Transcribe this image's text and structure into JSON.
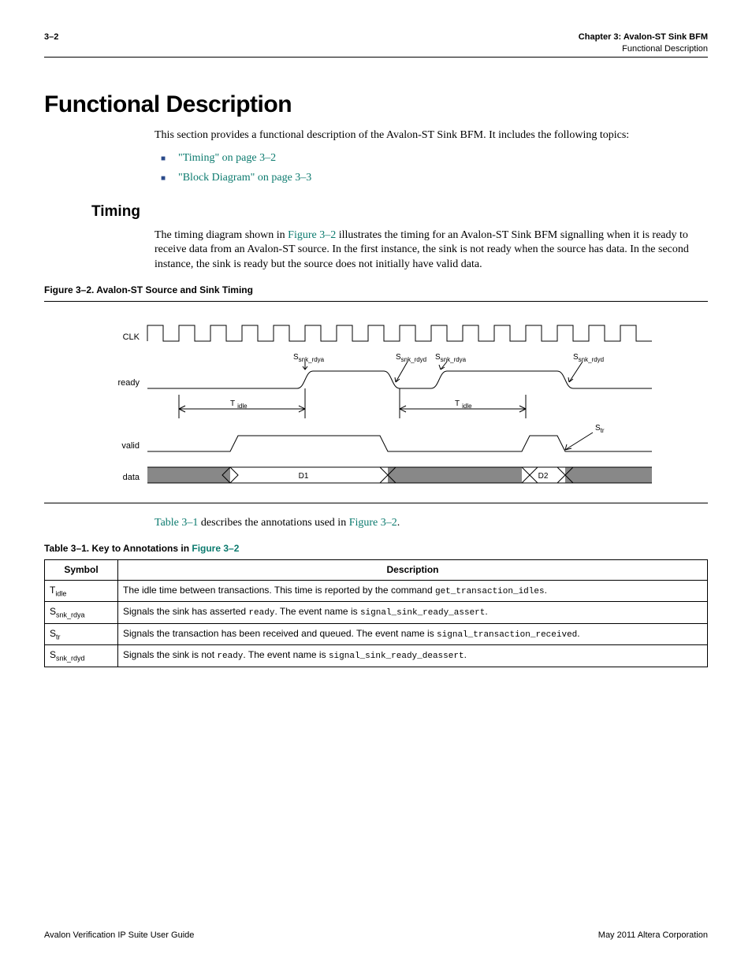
{
  "header": {
    "page_num": "3–2",
    "chapter": "Chapter 3: Avalon-ST Sink BFM",
    "section": "Functional Description"
  },
  "h1": "Functional Description",
  "intro": "This section provides a functional description of the Avalon-ST Sink BFM. It includes the following topics:",
  "bullets": [
    "\"Timing\" on page 3–2",
    "\"Block Diagram\" on page 3–3"
  ],
  "h2": "Timing",
  "timing_para_pre": "The timing diagram shown in ",
  "timing_para_link": "Figure 3–2",
  "timing_para_post": " illustrates the timing for an Avalon-ST Sink BFM signalling when it is ready to receive data from an Avalon-ST source. In the first instance, the sink is not ready when the source has data. In the second instance, the sink is ready but the source does not initially have valid data.",
  "fig_caption": "Figure 3–2. Avalon-ST Source and Sink Timing",
  "signals": {
    "clk": "CLK",
    "ready": "ready",
    "valid": "valid",
    "data": "data"
  },
  "annotations": {
    "s_snk_rdya": "S",
    "s_snk_rdya_sub": "snk_rdya",
    "s_snk_rdyd": "S",
    "s_snk_rdyd_sub": "snk_rdyd",
    "t_idle": "T",
    "t_idle_sub": "idle",
    "s_tr": "S",
    "s_tr_sub": "tr",
    "d1": "D1",
    "d2": "D2"
  },
  "mid_para_pre": "",
  "mid_link1": "Table 3–1",
  "mid_para_mid": " describes the annotations used in ",
  "mid_link2": "Figure 3–2",
  "mid_para_post": ".",
  "table_caption_pre": "Table 3–1. Key to Annotations in ",
  "table_caption_link": "Figure 3–2",
  "table": {
    "head_sym": "Symbol",
    "head_desc": "Description",
    "rows": [
      {
        "sym_main": "T",
        "sym_sub": "idle",
        "desc_a": "The idle time between transactions. This time is reported by the command ",
        "desc_code": "get_transaction_idles",
        "desc_b": "."
      },
      {
        "sym_main": "S",
        "sym_sub": "snk_rdya",
        "desc_a": "Signals the sink has asserted ",
        "desc_code": "ready",
        "desc_b": ". The event name is ",
        "desc_code2": "signal_sink_ready_assert",
        "desc_c": "."
      },
      {
        "sym_main": "S",
        "sym_sub": "tr",
        "desc_a": "Signals the transaction has been received and queued. The event name is ",
        "desc_code": "signal_transaction_received",
        "desc_b": "."
      },
      {
        "sym_main": "S",
        "sym_sub": "snk_rdyd",
        "desc_a": "Signals the sink is not ",
        "desc_code": "ready",
        "desc_b": ". The event name is ",
        "desc_code2": "signal_sink_ready_deassert",
        "desc_c": "."
      }
    ]
  },
  "footer": {
    "left": "Avalon Verification IP Suite User Guide",
    "right": "May 2011   Altera Corporation"
  }
}
